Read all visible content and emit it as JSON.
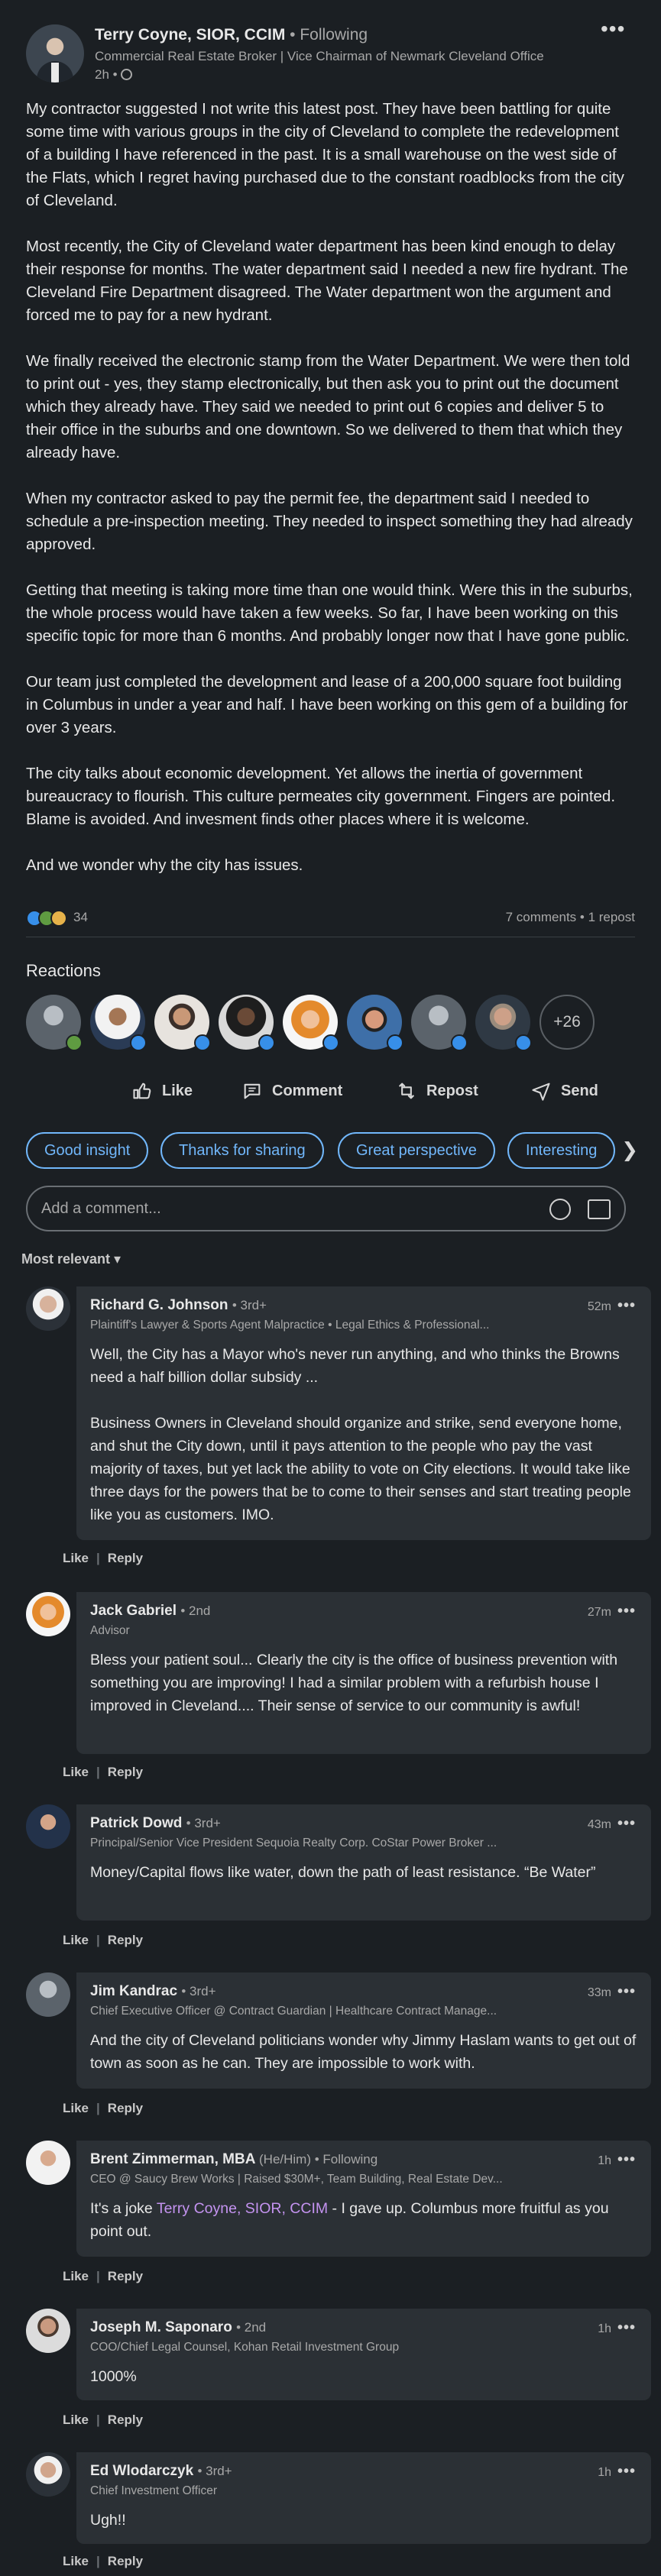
{
  "post": {
    "author_name": "Terry Coyne, SIOR, CCIM",
    "follow_status": "Following",
    "headline": "Commercial Real Estate Broker | Vice Chairman of Newmark Cleveland Office",
    "time": "2h •",
    "paragraphs": [
      "My contractor suggested I not write this latest post. They have been battling for quite some time with various groups in the city of Cleveland to complete the redevelopment of a building I have referenced in the past. It is a small warehouse on the west side of the Flats, which I regret having purchased due to the constant roadblocks from the city of Cleveland.",
      "Most recently, the City of Cleveland water department has been kind enough to delay their response for months. The water department said I needed a new fire hydrant. The Cleveland Fire Department disagreed. The Water department won the argument and forced me to pay for a new hydrant.",
      "We finally received the electronic stamp from the Water Department. We were then told to print out - yes, they stamp electronically, but then ask you to print out the document which they already have. They said we needed to print out 6 copies and deliver 5 to their office in the suburbs and one downtown. So we delivered to them that which they already have.",
      "When my contractor asked to pay the permit fee, the department said I needed to schedule a pre-inspection meeting. They needed to inspect something they had already approved.",
      "Getting that meeting is taking more time than one would think. Were this in the suburbs, the whole process would have taken a few weeks. So far, I have been working on this specific topic for more than 6 months. And probably longer now that I have gone public.",
      "Our team just completed the development and lease of a 200,000 square foot building in Columbus in under a year and half. I have been working on this gem of a building for over 3 years.",
      "The city talks about economic development. Yet allows the inertia of government bureaucracy to flourish. This culture permeates city government. Fingers are pointed. Blame is avoided. And invesment finds other places where it is welcome.",
      "And we wonder why the city has issues."
    ],
    "reaction_count": "34",
    "comments_reposts": "7 comments • 1 repost"
  },
  "reactions": {
    "title": "Reactions",
    "more": "+26"
  },
  "actions": {
    "like": "Like",
    "comment": "Comment",
    "repost": "Repost",
    "send": "Send"
  },
  "chips": [
    "Good insight",
    "Thanks for sharing",
    "Great perspective",
    "Interesting"
  ],
  "comment_box": {
    "placeholder": "Add a comment..."
  },
  "sort": "Most relevant ▾",
  "comment_actions": {
    "like": "Like",
    "reply": "Reply"
  },
  "comments": [
    {
      "name": "Richard G. Johnson",
      "degree": "• 3rd+",
      "headline": "Plaintiff's Lawyer & Sports Agent Malpractice • Legal Ethics & Professional...",
      "time": "52m",
      "paragraphs": [
        "Well, the City has a Mayor who's never run anything, and who thinks the Browns need a half billion dollar subsidy ...",
        "Business Owners in Cleveland should organize and strike, send everyone home, and shut the City down, until it pays attention to the people who pay the vast majority of taxes, but yet lack the ability to vote on City elections. It would take like three days for the powers that be to come to their senses and start treating people like you as customers. IMO."
      ]
    },
    {
      "name": "Jack Gabriel",
      "degree": "• 2nd",
      "headline": "Advisor",
      "time": "27m",
      "paragraphs": [
        "Bless your patient soul... Clearly the city is the office of business prevention with something you are improving! I had a similar problem with a refurbish house I improved in Cleveland.... Their sense of service to our community is awful!"
      ]
    },
    {
      "name": "Patrick Dowd",
      "degree": "• 3rd+",
      "headline": "Principal/Senior Vice President Sequoia Realty Corp. CoStar Power Broker ...",
      "time": "43m",
      "paragraphs": [
        "Money/Capital flows like water, down the path of least resistance. “Be Water”"
      ]
    },
    {
      "name": "Jim Kandrac",
      "degree": "• 3rd+",
      "headline": "Chief Executive Officer @ Contract Guardian | Healthcare Contract Manage...",
      "time": "33m",
      "paragraphs": [
        "And the city of Cleveland politicians wonder why Jimmy Haslam wants to get out of town as soon as he can. They are impossible to work with."
      ]
    },
    {
      "name": "Brent Zimmerman, MBA",
      "degree": "(He/Him) • Following",
      "headline": "CEO @ Saucy Brew Works | Raised $30M+, Team Building, Real Estate Dev...",
      "time": "1h",
      "text_before": "It's a joke ",
      "mention": "Terry Coyne, SIOR, CCIM",
      "text_after": " - I gave up. Columbus more fruitful as you point out."
    },
    {
      "name": "Joseph M. Saponaro",
      "degree": "• 2nd",
      "headline": "COO/Chief Legal Counsel, Kohan Retail Investment Group",
      "time": "1h",
      "paragraphs": [
        "1000%"
      ]
    },
    {
      "name": "Ed Wlodarczyk",
      "degree": "• 3rd+",
      "headline": "Chief Investment Officer",
      "time": "1h",
      "paragraphs": [
        "Ugh!!"
      ]
    }
  ],
  "colors": {
    "background": "#1b1f23",
    "card": "#2b3035",
    "accent": "#71b7fb",
    "mention": "#c493f0",
    "muted": "#a8a8a8"
  }
}
